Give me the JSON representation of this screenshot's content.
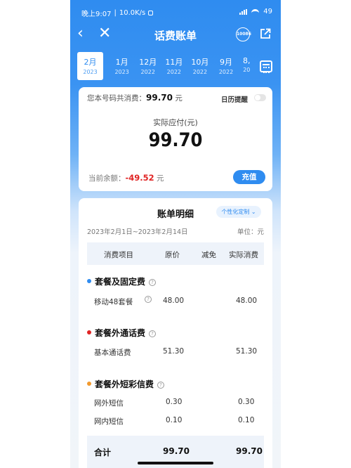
{
  "status_bar": {
    "time": "晚上9:07",
    "speed": "10.0K/s",
    "battery": "49"
  },
  "nav": {
    "back": "‹",
    "close": "✕",
    "title": "话费账单",
    "badge": "10086",
    "share_icon": "share-icon"
  },
  "months": [
    {
      "m": "2月",
      "y": "2023"
    },
    {
      "m": "1月",
      "y": "2023"
    },
    {
      "m": "12月",
      "y": "2022"
    },
    {
      "m": "11月",
      "y": "2022"
    },
    {
      "m": "10月",
      "y": "2022"
    },
    {
      "m": "9月",
      "y": "2022"
    },
    {
      "m": "8,",
      "y": "20"
    }
  ],
  "summary": {
    "total_label": "您本号码共消费：",
    "total_value": "99.70",
    "total_unit": "元",
    "remind_label": "日历提醒",
    "remind_on": false,
    "due_label": "实际应付(元)",
    "due_amount": "99.70",
    "balance_label": "当前余额：",
    "balance_value": "-49.52",
    "balance_unit": "元",
    "recharge_label": "充值"
  },
  "detail": {
    "title": "账单明细",
    "custom_label": "个性化定制",
    "period": "2023年2月1日~2023年2月14日",
    "unit": "单位：元",
    "headers": [
      "消费项目",
      "原价",
      "减免",
      "实际消费"
    ],
    "sections": [
      {
        "name": "套餐及固定费",
        "color": "#2f8cf0",
        "rows": [
          {
            "item": "移动48套餐",
            "price": "48.00",
            "discount": "",
            "actual": "48.00",
            "help": true
          }
        ]
      },
      {
        "name": "套餐外通话费",
        "color": "#e02424",
        "rows": [
          {
            "item": "基本通话费",
            "price": "51.30",
            "discount": "",
            "actual": "51.30",
            "help": false
          }
        ]
      },
      {
        "name": "套餐外短彩信费",
        "color": "#f29a2e",
        "rows": [
          {
            "item": "网外短信",
            "price": "0.30",
            "discount": "",
            "actual": "0.30",
            "help": false
          },
          {
            "item": "网内短信",
            "price": "0.10",
            "discount": "",
            "actual": "0.10",
            "help": false
          }
        ]
      }
    ],
    "total": {
      "label": "合计",
      "price": "99.70",
      "actual": "99.70"
    }
  },
  "colors": {
    "accent": "#2f8cf0",
    "negative": "#e02424"
  }
}
